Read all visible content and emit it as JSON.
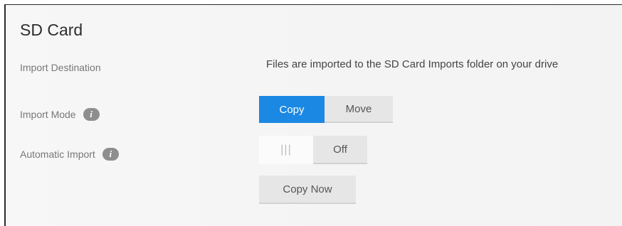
{
  "section": {
    "title": "SD Card"
  },
  "import_destination": {
    "label": "Import Destination",
    "text": "Files are imported to the SD Card Imports folder on your drive"
  },
  "import_mode": {
    "label": "Import Mode",
    "info_icon": "i",
    "options": [
      "Copy",
      "Move"
    ],
    "selected": "Copy"
  },
  "automatic_import": {
    "label": "Automatic Import",
    "info_icon": "i",
    "handle_glyph": "|||",
    "state": "Off"
  },
  "copy_now": {
    "label": "Copy Now"
  },
  "colors": {
    "accent": "#1b88e3",
    "button_bg": "#e6e6e6",
    "info_icon_bg": "#8e8e8e"
  }
}
